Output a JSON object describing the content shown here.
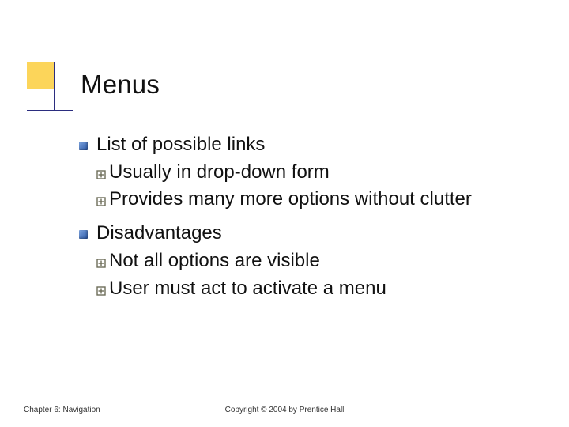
{
  "slide": {
    "title": "Menus",
    "bullets": [
      {
        "text": "List of possible links",
        "children": [
          {
            "text": "Usually in drop-down form"
          },
          {
            "text": "Provides many more options without clutter"
          }
        ]
      },
      {
        "text": "Disadvantages",
        "children": [
          {
            "text": "Not all options are visible"
          },
          {
            "text": "User must act to activate a menu"
          }
        ]
      }
    ],
    "footer": {
      "left": "Chapter 6: Navigation",
      "center": "Copyright © 2004 by Prentice Hall"
    }
  },
  "icons": {
    "plus_bullet": "plus-diamond"
  }
}
